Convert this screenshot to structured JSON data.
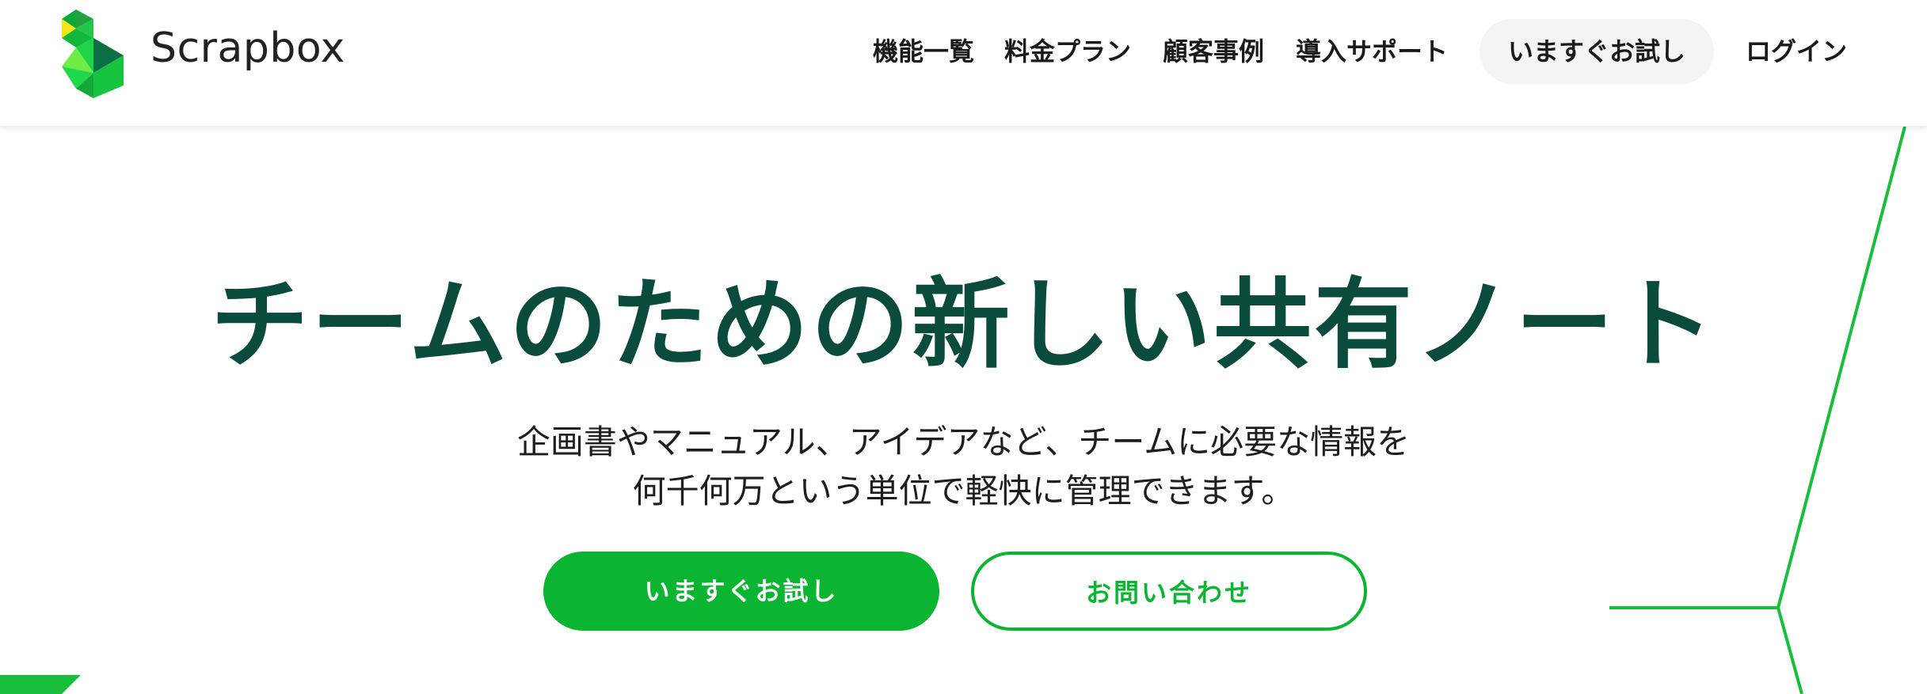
{
  "brand": {
    "name": "Scrapbox",
    "accent": "#0bb531",
    "heading_color": "#0a4b3c"
  },
  "nav": {
    "features": "機能一覧",
    "pricing": "料金プラン",
    "cases": "顧客事例",
    "support": "導入サポート",
    "trial": "いますぐお試し",
    "login": "ログイン"
  },
  "hero": {
    "title": "チームのための新しい共有ノート",
    "description_line1": "企画書やマニュアル、アイデアなど、チームに必要な情報を",
    "description_line2": "何千何万という単位で軽快に管理できます。",
    "primary_button": "いますぐお試し",
    "secondary_button": "お問い合わせ"
  }
}
